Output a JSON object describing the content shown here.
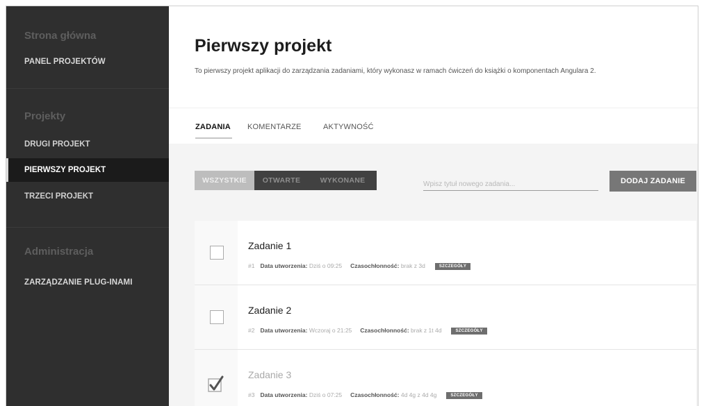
{
  "sidebar": {
    "home_heading": "Strona główna",
    "panel_link": "PANEL PROJEKTÓW",
    "projects_heading": "Projekty",
    "projects": [
      {
        "label": "DRUGI PROJEKT",
        "active": false
      },
      {
        "label": "PIERWSZY PROJEKT",
        "active": true
      },
      {
        "label": "TRZECI PROJEKT",
        "active": false
      }
    ],
    "admin_heading": "Administracja",
    "plugins_link": "ZARZĄDZANIE PLUG-INAMI"
  },
  "project": {
    "title": "Pierwszy projekt",
    "description": "To pierwszy projekt aplikacji do zarządzania zadaniami, który wykonasz w ramach ćwiczeń do książki o komponentach Angulara 2."
  },
  "tabs": [
    {
      "label": "ZADANIA",
      "active": true
    },
    {
      "label": "KOMENTARZE",
      "active": false
    },
    {
      "label": "AKTYWNOŚĆ",
      "active": false
    }
  ],
  "filters": [
    {
      "label": "WSZYSTKIE",
      "active": true
    },
    {
      "label": "OTWARTE",
      "active": false
    },
    {
      "label": "WYKONANE",
      "active": false
    }
  ],
  "new_task": {
    "placeholder": "Wpisz tytuł nowego zadania..."
  },
  "add_button": "DODAJ ZADANIE",
  "task_labels": {
    "created": "Data utworzenia:",
    "effort": "Czasochłonność:",
    "details": "SZCZEGÓŁY"
  },
  "tasks": [
    {
      "title": "Zadanie 1",
      "number": "#1",
      "created": "Dziś o 09:25",
      "effort": "brak z 3d",
      "done": false
    },
    {
      "title": "Zadanie 2",
      "number": "#2",
      "created": "Wczoraj o 21:25",
      "effort": "brak z 1t 4d",
      "done": false
    },
    {
      "title": "Zadanie 3",
      "number": "#3",
      "created": "Dziś o 07:25",
      "effort": "4d 4g z 4d 4g",
      "done": true
    }
  ],
  "colors": {
    "sidebar_bg": "#2f2f2f",
    "sidebar_active_bg": "#1b1b1b",
    "add_button_bg": "#777777",
    "filter_active_bg": "#bdbdbd",
    "filter_bg": "#414141"
  }
}
